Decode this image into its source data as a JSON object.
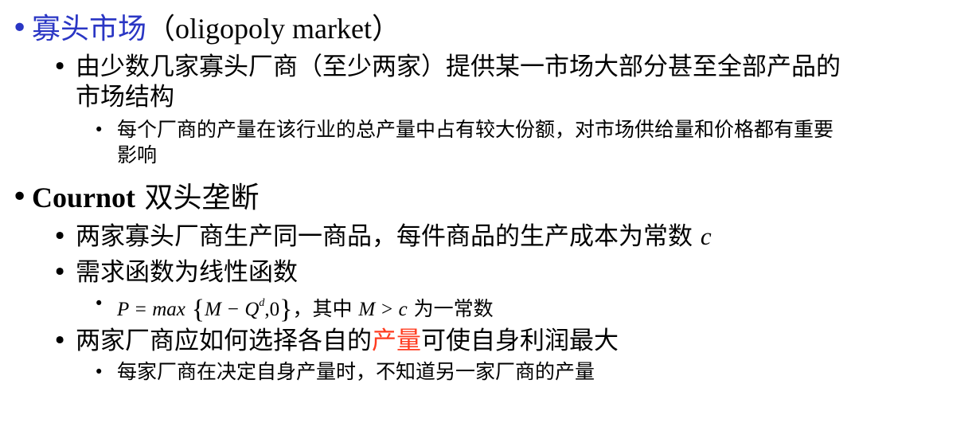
{
  "slide": {
    "oligopoly": {
      "title_cn": "寡头市场",
      "title_en": "（oligopoly market）",
      "definition_line1": "由少数几家寡头厂商（至少两家）提供某一市场大部分甚至全部产品的",
      "definition_line2": "市场结构",
      "detail_line1": "每个厂商的产量在该行业的总产量中占有较大份额，对市场供给量和价格都有重要",
      "detail_line2": "影响"
    },
    "cournot": {
      "title_en": "Cournot",
      "title_cn": "双头垄断",
      "point1_text": "两家寡头厂商生产同一商品，每件商品的生产成本为常数",
      "point1_var": "c",
      "point2": "需求函数为线性函数",
      "formula": {
        "lhs": "P = max",
        "inner_a": "M − Q",
        "inner_sup": "d",
        "inner_b": ",0",
        "suffix_cn": "，其中",
        "cond": "M > c",
        "cond_cn": "为一常数"
      },
      "point3_before": "两家厂商应如何选择各自的",
      "point3_highlight": "产量",
      "point3_after": "可使自身利润最大",
      "point3_sub": "每家厂商在决定自身产量时，不知道另一家厂商的产量"
    },
    "bullet_char": "•"
  },
  "colors": {
    "title_blue": "#2a36c4",
    "highlight_red": "#ff3b1f",
    "text": "#000000"
  }
}
